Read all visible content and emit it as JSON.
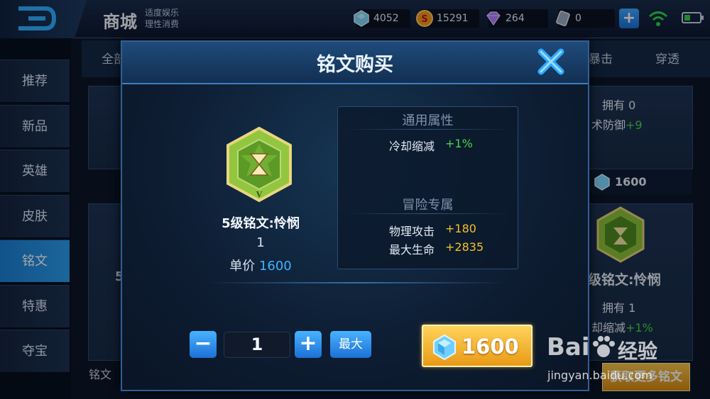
{
  "header": {
    "title": "商城",
    "slogan_line1": "适度娱乐",
    "slogan_line2": "理性消费",
    "currencies": [
      {
        "name": "diamond-coupon",
        "value": "4052"
      },
      {
        "name": "gold-coin",
        "value": "15291"
      },
      {
        "name": "gem",
        "value": "264"
      },
      {
        "name": "token",
        "value": "0"
      }
    ],
    "add_label": "+"
  },
  "sidebar": {
    "items": [
      {
        "label": "推荐"
      },
      {
        "label": "新品"
      },
      {
        "label": "英雄"
      },
      {
        "label": "皮肤"
      },
      {
        "label": "铭文",
        "active": true
      },
      {
        "label": "特惠"
      },
      {
        "label": "夺宝"
      }
    ]
  },
  "background": {
    "tab_all": "全部",
    "tab_crit": "暴击",
    "tab_pen": "穿透",
    "card1_own": "拥有 0",
    "card1_attr": "术防御",
    "card1_attr_val": "+9",
    "card2_price": "1600",
    "card2_name": "级铭文:怜悯",
    "card2_own": "拥有 1",
    "card2_attr": "却缩减",
    "card2_attr_val": "+1%",
    "card2_btn": "获取更多铭文",
    "left_partial_1": "5",
    "bottom_label": "铭文"
  },
  "modal": {
    "title": "铭文购买",
    "item": {
      "name": "5级铭文:怜悯",
      "quantity": "1",
      "unit_price_label": "单价",
      "unit_price": "1600"
    },
    "attributes": {
      "general_header": "通用属性",
      "general": [
        {
          "key": "冷却缩减",
          "value": "+1%",
          "color": "#46d64a"
        }
      ],
      "adventure_header": "冒险专属",
      "adventure": [
        {
          "key": "物理攻击",
          "value": "+180",
          "color": "#f4c12c"
        },
        {
          "key": "最大生命",
          "value": "+2835",
          "color": "#f4c12c"
        }
      ]
    },
    "controls": {
      "minus": "−",
      "plus": "+",
      "quantity_value": "1",
      "max_label": "最大",
      "buy_price": "1600"
    }
  },
  "watermark": {
    "brand_a": "Bai",
    "brand_b": "经验",
    "url": "jingyan.baidu.com"
  },
  "colors": {
    "accent": "#2a9dee",
    "gold": "#f4c12c",
    "green": "#46d64a",
    "price_blue": "#3fb3ff"
  }
}
